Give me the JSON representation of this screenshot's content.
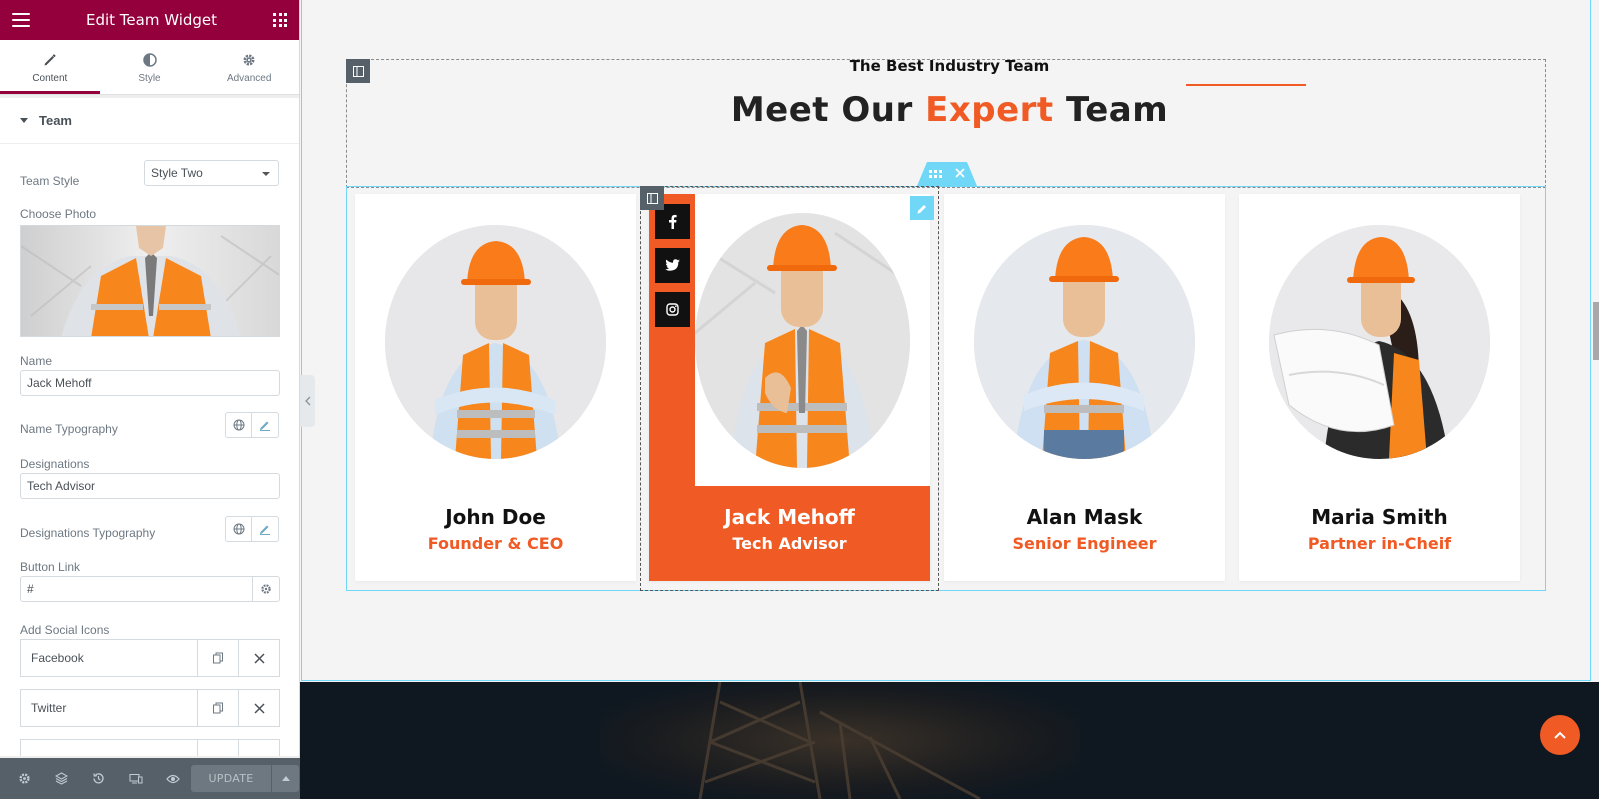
{
  "panel": {
    "title": "Edit Team Widget",
    "tabs": [
      {
        "label": "Content",
        "icon": "pencil-icon"
      },
      {
        "label": "Style",
        "icon": "half-circle-icon"
      },
      {
        "label": "Advanced",
        "icon": "gear-icon"
      }
    ],
    "section_title": "Team",
    "team_style_label": "Team Style",
    "team_style_value": "Style Two",
    "choose_photo_label": "Choose Photo",
    "name_label": "Name",
    "name_value": "Jack Mehoff",
    "name_typography_label": "Name Typography",
    "designations_label": "Designations",
    "designations_value": "Tech Advisor",
    "designations_typography_label": "Designations Typography",
    "button_link_label": "Button Link",
    "button_link_value": "#",
    "add_social_icons_label": "Add Social Icons",
    "social_items": [
      "Facebook",
      "Twitter"
    ],
    "update_label": "UPDATE"
  },
  "preview": {
    "subtitle": "The Best Industry Team",
    "title_part1": "Meet Our ",
    "title_accent": "Expert",
    "title_part2": " Team",
    "team": [
      {
        "name": "John Doe",
        "designation": "Founder & CEO"
      },
      {
        "name": "Jack Mehoff",
        "designation": "Tech Advisor"
      },
      {
        "name": "Alan Mask",
        "designation": "Senior Engineer"
      },
      {
        "name": "Maria Smith",
        "designation": "Partner in-Cheif"
      }
    ]
  },
  "colors": {
    "panel_header": "#93003c",
    "accent": "#f05a24",
    "editor_outline": "#71d7f7"
  }
}
